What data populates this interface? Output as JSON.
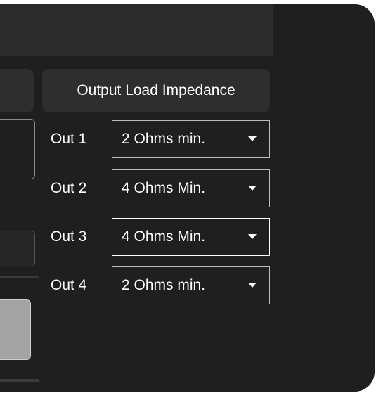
{
  "impedance_panel": {
    "title": "Output Load Impedance",
    "outputs": [
      {
        "label": "Out 1",
        "value": "2 Ohms min."
      },
      {
        "label": "Out 2",
        "value": "4 Ohms Min."
      },
      {
        "label": "Out 3",
        "value": "4 Ohms Min."
      },
      {
        "label": "Out 4",
        "value": "2 Ohms min."
      }
    ]
  },
  "colors": {
    "window_bg": "#1f1f1f",
    "panel_bg": "#2e2e2e",
    "text": "#ffffff",
    "dropdown_border": "#bdbdbd"
  },
  "icons": {
    "dropdown": "chevron-down-icon"
  }
}
